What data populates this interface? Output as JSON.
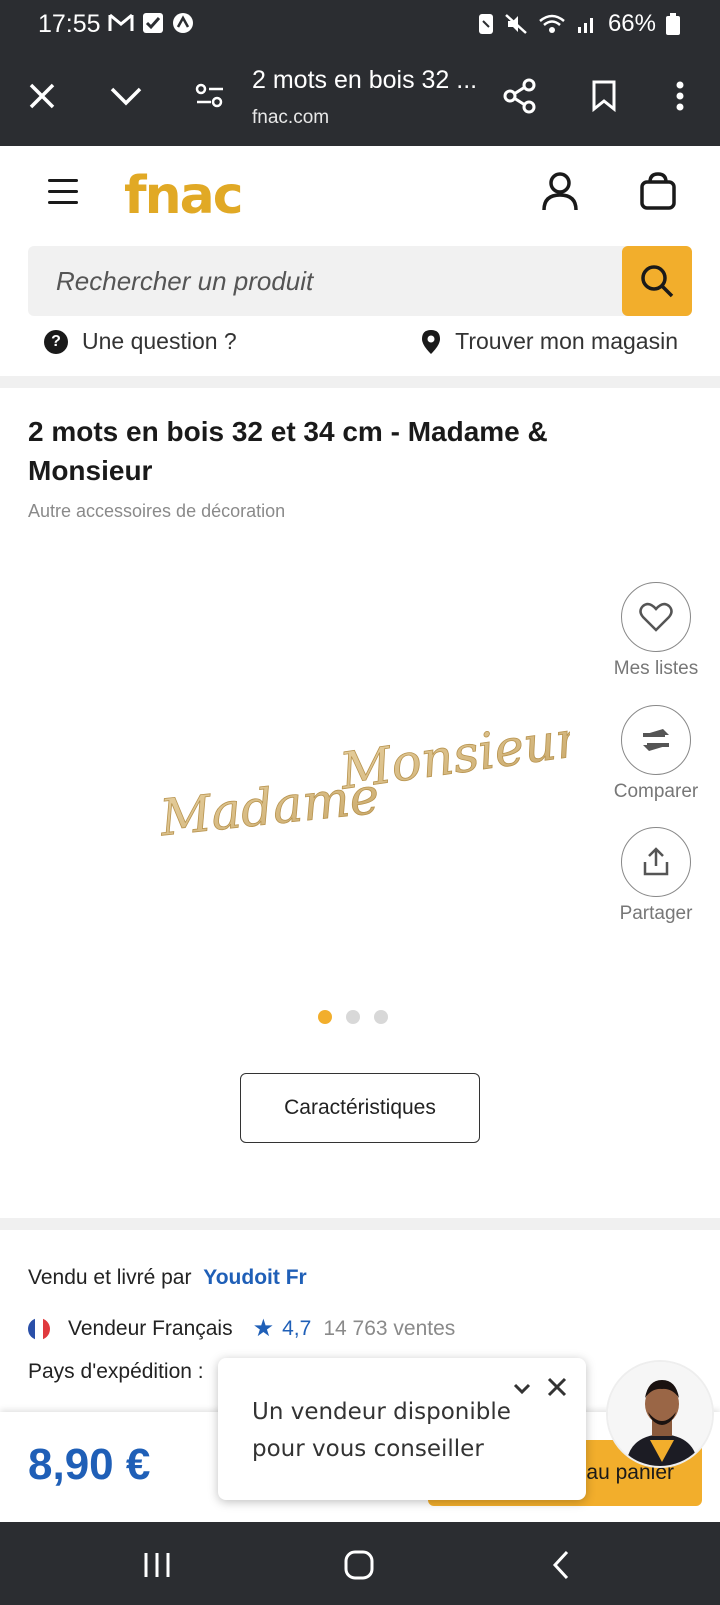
{
  "status_bar": {
    "time": "17:55",
    "battery": "66%",
    "left_icons": [
      "gmail-icon",
      "checkbox-icon",
      "vpn-icon"
    ],
    "right_icons": [
      "nfc-icon",
      "mute-icon",
      "wifi-icon",
      "signal-icon",
      "battery-icon"
    ]
  },
  "browser": {
    "title": "2 mots en bois 32 ...",
    "url": "fnac.com"
  },
  "header": {
    "logo": "fnac",
    "search_placeholder": "Rechercher un produit",
    "help_label": "Une question ?",
    "store_label": "Trouver mon magasin"
  },
  "product": {
    "title": "2 mots en bois 32 et 34 cm - Madame & Monsieur",
    "category": "Autre accessoires de décoration",
    "image_words": [
      "Madame",
      "Monsieur"
    ],
    "actions": {
      "wishlist": "Mes listes",
      "compare": "Comparer",
      "share": "Partager"
    },
    "image_count": 3,
    "active_image": 1,
    "spec_button": "Caractéristiques"
  },
  "seller": {
    "prefix": "Vendu et livré par",
    "name": "Youdoit Fr",
    "type": "Vendeur Français",
    "rating": "4,7",
    "sales": "14 763 ventes",
    "shipping_label": "Pays d'expédition :"
  },
  "purchase": {
    "price": "8,90 €",
    "cart_button": "au panier"
  },
  "chat": {
    "message": "Un vendeur disponible pour vous conseiller"
  },
  "colors": {
    "brand_yellow": "#f2ae2c",
    "link_blue": "#1f5fb7",
    "dark_bar": "#2b2d31"
  }
}
